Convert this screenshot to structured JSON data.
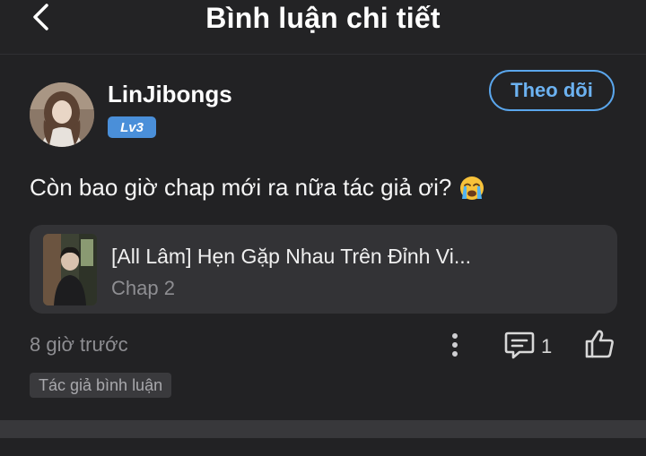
{
  "header": {
    "title": "Bình luận chi tiết"
  },
  "comment": {
    "username": "LinJibongs",
    "level": "Lv3",
    "follow_label": "Theo dõi",
    "text": "Còn bao giờ chap mới ra nữa tác giả ơi?",
    "emoji": "loudly-crying-face-icon",
    "timestamp": "8 giờ trước",
    "reply_count": "1",
    "author_tag": "Tác giả bình luận"
  },
  "story_card": {
    "title": "[All Lâm] Hẹn Gặp Nhau Trên Đỉnh Vi...",
    "chapter": "Chap 2"
  },
  "colors": {
    "background": "#222224",
    "accent": "#5aa6ec",
    "level_badge": "#4a8fd9",
    "muted_text": "#8e8e92"
  }
}
